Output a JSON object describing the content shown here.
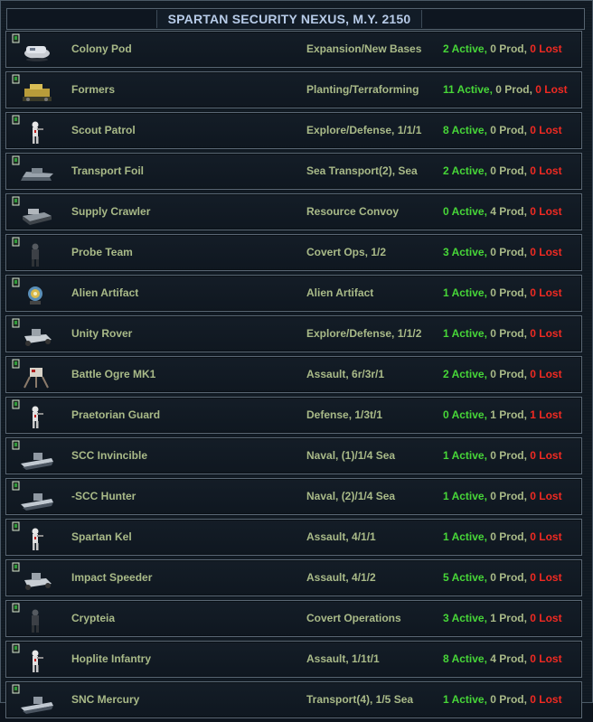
{
  "header": {
    "title": "SPARTAN SECURITY NEXUS,  M.Y. 2150"
  },
  "colors": {
    "name_text": "#a9ba88",
    "active_text": "#47d638",
    "lost_text": "#f02a22",
    "title_text": "#b7cbe8"
  },
  "units": [
    {
      "name": "Colony Pod",
      "role": "Expansion/New Bases",
      "active": "2 Active,",
      "prod": " 0 Prod, ",
      "lost": "0 Lost",
      "icon": "colony-pod-icon"
    },
    {
      "name": "Formers",
      "role": "Planting/Terraforming",
      "active": "11 Active,",
      "prod": " 0 Prod, ",
      "lost": "0 Lost",
      "icon": "former-icon"
    },
    {
      "name": "Scout Patrol",
      "role": "Explore/Defense, 1/1/1",
      "active": "8 Active,",
      "prod": " 0 Prod, ",
      "lost": "0 Lost",
      "icon": "infantry-icon"
    },
    {
      "name": "Transport Foil",
      "role": "Sea Transport(2),  Sea",
      "active": "2 Active,",
      "prod": " 0 Prod, ",
      "lost": "0 Lost",
      "icon": "foil-icon"
    },
    {
      "name": "Supply Crawler",
      "role": "Resource Convoy",
      "active": "0 Active,",
      "prod": " 4 Prod, ",
      "lost": "0 Lost",
      "icon": "crawler-icon"
    },
    {
      "name": "Probe Team",
      "role": "Covert Ops, 1/2",
      "active": "3 Active,",
      "prod": " 0 Prod, ",
      "lost": "0 Lost",
      "icon": "probe-team-icon"
    },
    {
      "name": "Alien Artifact",
      "role": "Alien Artifact",
      "active": "1 Active,",
      "prod": " 0 Prod, ",
      "lost": "0 Lost",
      "icon": "artifact-icon"
    },
    {
      "name": "Unity Rover",
      "role": "Explore/Defense, 1/1/2",
      "active": "1 Active,",
      "prod": " 0 Prod, ",
      "lost": "0 Lost",
      "icon": "rover-icon"
    },
    {
      "name": "Battle Ogre MK1",
      "role": "Assault, 6r/3r/1",
      "active": "2 Active,",
      "prod": " 0 Prod, ",
      "lost": "0 Lost",
      "icon": "battle-ogre-icon"
    },
    {
      "name": "Praetorian Guard",
      "role": "Defense, 1/3t/1",
      "active": "0 Active,",
      "prod": " 1 Prod, ",
      "lost": "1 Lost",
      "icon": "infantry-icon"
    },
    {
      "name": "SCC Invincible",
      "role": "Naval, (1)/1/4 Sea",
      "active": "1 Active,",
      "prod": " 0 Prod, ",
      "lost": "0 Lost",
      "icon": "ship-icon"
    },
    {
      "name": "-SCC Hunter",
      "role": "Naval, (2)/1/4 Sea",
      "active": "1 Active,",
      "prod": " 0 Prod, ",
      "lost": "0 Lost",
      "icon": "ship-icon"
    },
    {
      "name": "Spartan Kel",
      "role": "Assault, 4/1/1",
      "active": "1 Active,",
      "prod": " 0 Prod, ",
      "lost": "0 Lost",
      "icon": "infantry-icon"
    },
    {
      "name": "Impact Speeder",
      "role": "Assault, 4/1/2",
      "active": "5 Active,",
      "prod": " 0 Prod, ",
      "lost": "0 Lost",
      "icon": "rover-icon"
    },
    {
      "name": "Crypteia",
      "role": "Covert Operations",
      "active": "3 Active,",
      "prod": " 1 Prod, ",
      "lost": "0 Lost",
      "icon": "probe-team-icon"
    },
    {
      "name": "Hoplite Infantry",
      "role": "Assault, 1/1t/1",
      "active": "8 Active,",
      "prod": " 4 Prod, ",
      "lost": "0 Lost",
      "icon": "infantry-icon"
    },
    {
      "name": "SNC Mercury",
      "role": "Transport(4), 1/5 Sea",
      "active": "1 Active,",
      "prod": " 0 Prod, ",
      "lost": "0 Lost",
      "icon": "ship-icon"
    }
  ]
}
